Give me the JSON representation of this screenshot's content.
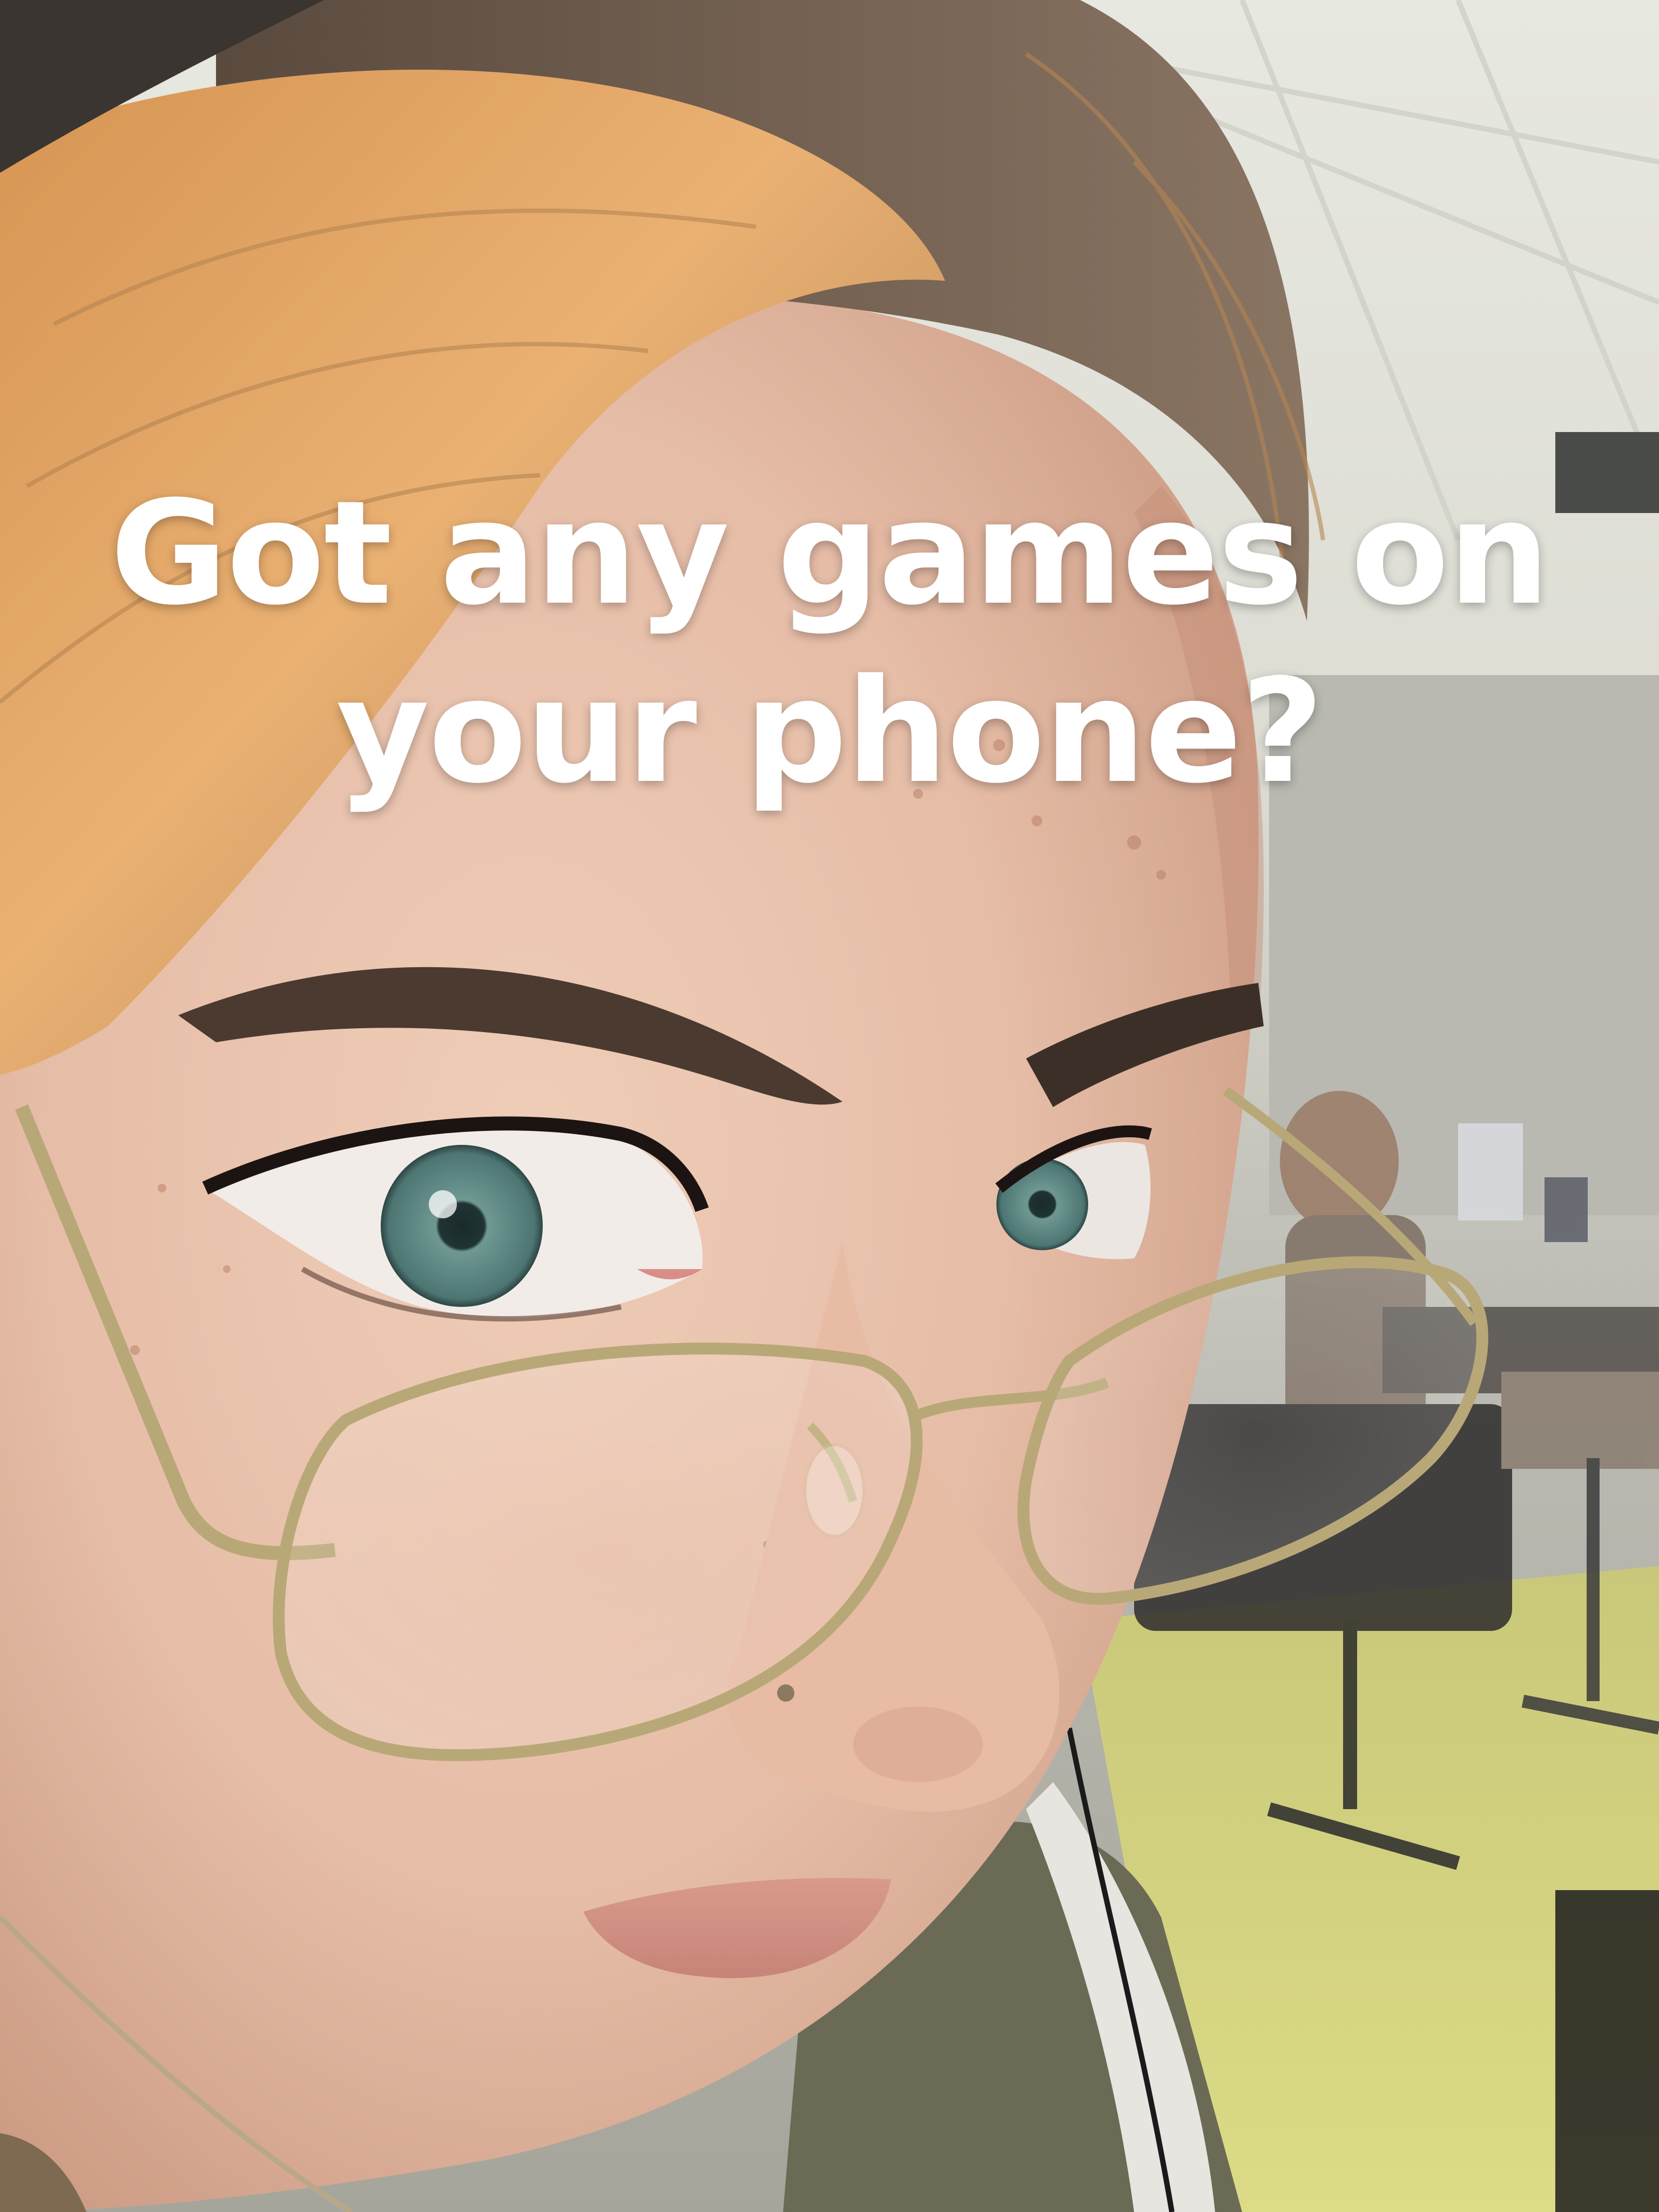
{
  "caption": {
    "line1": "Got any games on",
    "line2": "your phone?"
  },
  "colors": {
    "caption_text": "#ffffff",
    "hair": "#e2a663",
    "skin": "#e9c2ad",
    "eye_iris": "#5e8a87",
    "glasses_frame": "#b9a877",
    "floor": "#d8d77a",
    "ceiling": "#e6e6de",
    "shirt": "#6b6a55"
  }
}
